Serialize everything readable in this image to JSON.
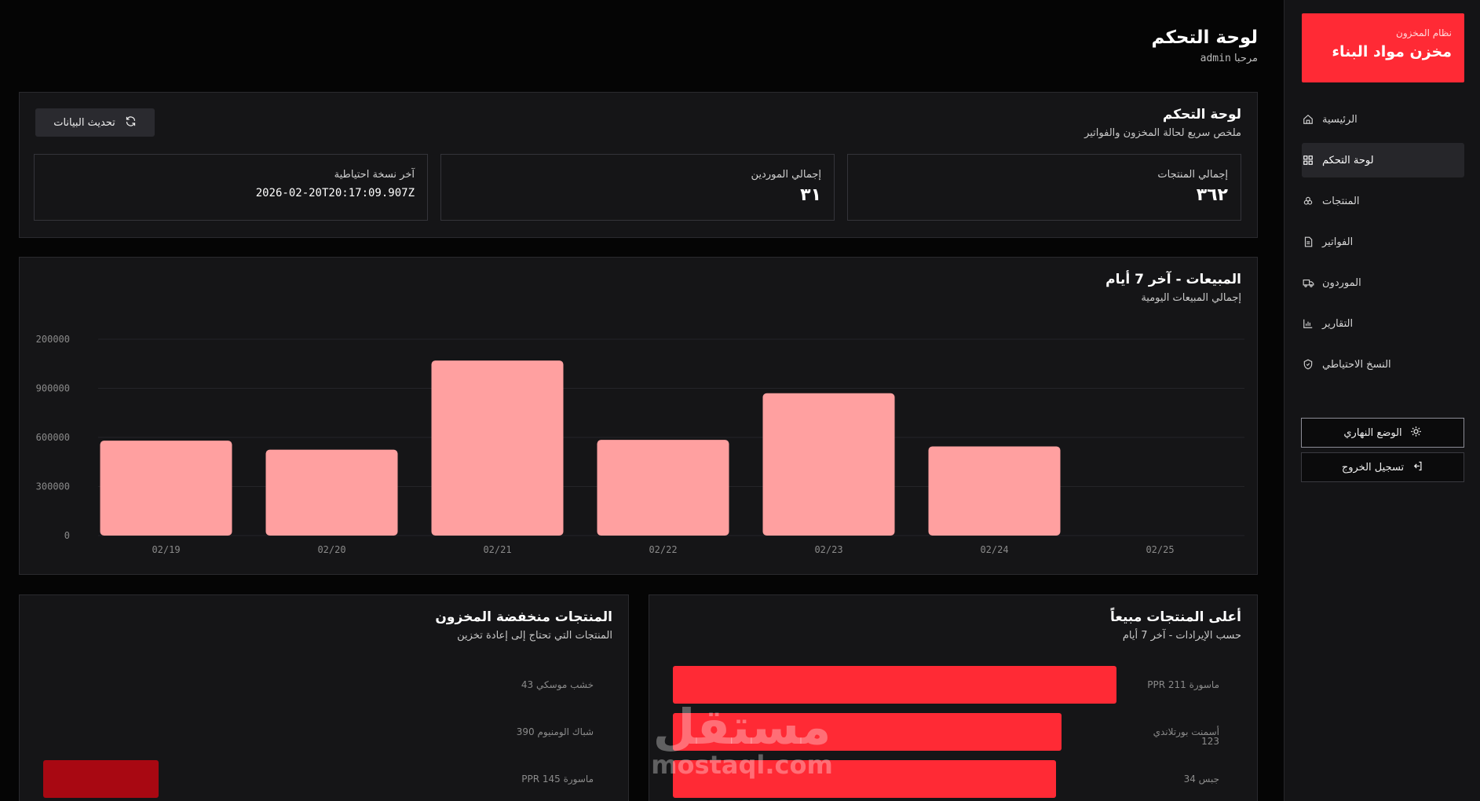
{
  "sidebar": {
    "brand_sub": "نظام المخزون",
    "brand_title": "مخزن مواد البناء",
    "items": [
      {
        "label": "الرئيسية",
        "icon": "home-icon"
      },
      {
        "label": "لوحة التحكم",
        "icon": "grid-icon",
        "active": true
      },
      {
        "label": "المنتجات",
        "icon": "boxes-icon"
      },
      {
        "label": "الفواتير",
        "icon": "file-icon"
      },
      {
        "label": "الموردون",
        "icon": "truck-icon"
      },
      {
        "label": "التقارير",
        "icon": "chart-icon"
      },
      {
        "label": "النسخ الاحتياطي",
        "icon": "shield-icon"
      }
    ],
    "light_mode": "الوضع النهاري",
    "logout": "تسجيل الخروج"
  },
  "header": {
    "title": "لوحة التحكم",
    "welcome": "مرحبا",
    "user": "admin"
  },
  "summary": {
    "title": "لوحة التحكم",
    "subtitle": "ملخص سريع لحالة المخزون والفواتير",
    "refresh": "تحديث البيانات",
    "stats": [
      {
        "label": "إجمالي المنتجات",
        "value": "٣٦٢"
      },
      {
        "label": "إجمالي الموردين",
        "value": "٣١"
      },
      {
        "label": "آخر نسخة احتياطية",
        "value": "2026-02-20T20:17:09.907Z"
      }
    ]
  },
  "chart_data": [
    {
      "type": "bar",
      "title": "المبيعات - آخر 7 أيام",
      "subtitle": "إجمالي المبيعات اليومية",
      "categories": [
        "02/19",
        "02/20",
        "02/21",
        "02/22",
        "02/23",
        "02/24",
        "02/25"
      ],
      "values": [
        580000,
        525000,
        1070000,
        585000,
        870000,
        545000,
        0
      ],
      "y_ticks": [
        "0",
        "300000",
        "600000",
        "900000",
        "200000"
      ],
      "ylim": [
        0,
        1200000
      ],
      "color": "#ffa0a0",
      "grid": true
    },
    {
      "type": "bar",
      "orientation": "horizontal",
      "title": "أعلى المنتجات مبيعاً",
      "subtitle": "حسب الإيرادات - آخر 7 أيام",
      "categories": [
        "ماسورة PPR 211",
        "أسمنت بورتلاندي 123",
        "جبس 34"
      ],
      "values": [
        1.0,
        0.876,
        0.863
      ],
      "color": "#ff2a35"
    },
    {
      "type": "bar",
      "orientation": "horizontal",
      "title": "المنتجات منخفضة المخزون",
      "subtitle": "المنتجات التي تحتاج إلى إعادة تخزين",
      "categories": [
        "خشب موسكي 43",
        "شباك الومنيوم 390",
        "ماسورة PPR 145"
      ],
      "values": [
        0,
        0,
        0.21
      ],
      "color": "#a80812"
    }
  ],
  "watermark": {
    "ar": "مستقل",
    "en": "mostaql.com"
  }
}
